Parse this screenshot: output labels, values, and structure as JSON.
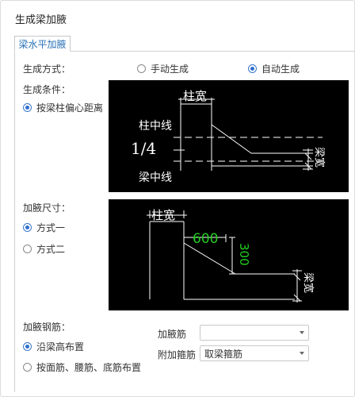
{
  "title": "生成梁加腋",
  "tab": {
    "label": "梁水平加腋"
  },
  "gen_method": {
    "label": "生成方式：",
    "options": [
      {
        "label": "手动生成",
        "selected": false
      },
      {
        "label": "自动生成",
        "selected": true
      }
    ]
  },
  "gen_condition": {
    "label": "生成条件：",
    "option": {
      "label": "按梁柱偏心距离",
      "selected": true
    },
    "diagram": {
      "col_width": "柱宽",
      "col_center": "柱中线",
      "fraction": "1/4",
      "beam_center": "梁中线",
      "beam_width": "梁宽"
    }
  },
  "haunch_size": {
    "label": "加腋尺寸：",
    "options": [
      {
        "label": "方式一",
        "selected": true
      },
      {
        "label": "方式二",
        "selected": false
      }
    ],
    "diagram": {
      "col_width": "柱宽",
      "length": "600",
      "height": "300",
      "beam_width": "梁宽"
    }
  },
  "haunch_rebar": {
    "label": "加腋钢筋：",
    "options": [
      {
        "label": "沿梁高布置",
        "selected": true
      },
      {
        "label": "按面筋、腰筋、底筋布置",
        "selected": false
      }
    ],
    "rebar_field": {
      "label": "加腋筋",
      "value": ""
    },
    "stirrup_field": {
      "label": "附加箍筋",
      "value": "取梁箍筋"
    }
  },
  "colors": {
    "accent": "#2f6fd0",
    "diagram_bg": "#000000",
    "diagram_line": "#ffffff",
    "dimension_green": "#22cc22"
  }
}
